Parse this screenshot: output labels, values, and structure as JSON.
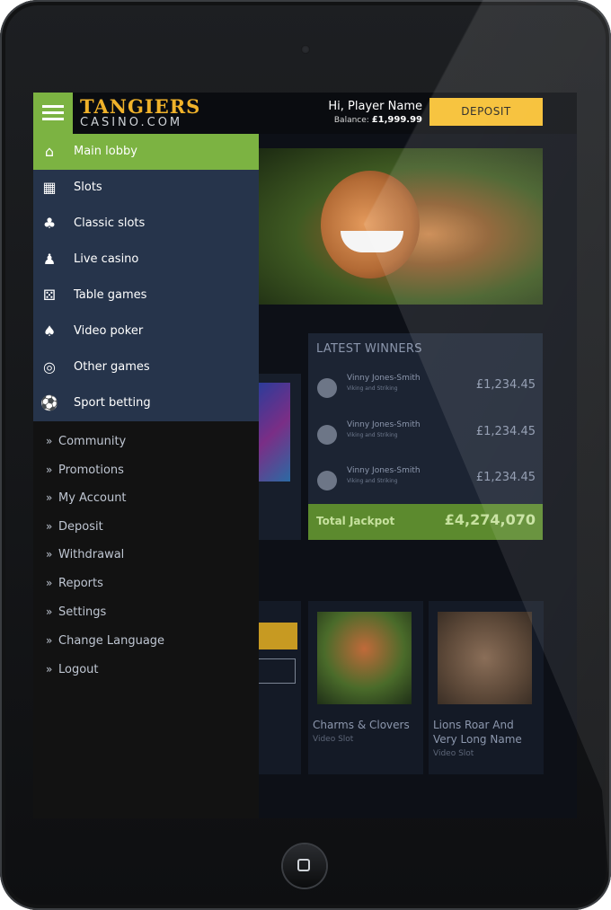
{
  "header": {
    "logo_line1": "TANGIERS",
    "logo_line2": "CASINO.COM",
    "greeting": "Hi, Player Name",
    "balance_label": "Balance:",
    "balance_value": "£1,999.99",
    "deposit_label": "DEPOSIT"
  },
  "menu": {
    "items": [
      {
        "label": "Main lobby",
        "icon": "home-icon",
        "active": true
      },
      {
        "label": "Slots",
        "icon": "slot-machine-icon"
      },
      {
        "label": "Classic slots",
        "icon": "cherries-icon"
      },
      {
        "label": "Live casino",
        "icon": "dealer-icon"
      },
      {
        "label": "Table games",
        "icon": "dice-icon"
      },
      {
        "label": "Video poker",
        "icon": "cards-icon"
      },
      {
        "label": "Other games",
        "icon": "chip-icon"
      },
      {
        "label": "Sport betting",
        "icon": "football-icon"
      }
    ],
    "sub_items": [
      "Community",
      "Promotions",
      "My Account",
      "Deposit",
      "Withdrawal",
      "Reports",
      "Settings",
      "Change Language",
      "Logout"
    ]
  },
  "winners": {
    "title": "LATEST WINNERS",
    "rows": [
      {
        "name": "Vinny Jones-Smith",
        "game": "Viking and Striking",
        "amount": "£1,234.45"
      },
      {
        "name": "Vinny Jones-Smith",
        "game": "Viking and Striking",
        "amount": "£1,234.45"
      },
      {
        "name": "Vinny Jones-Smith",
        "game": "Viking and Striking",
        "amount": "£1,234.45"
      }
    ],
    "jackpot_label": "Total Jackpot",
    "jackpot_value": "£4,274,070"
  },
  "games": [
    {
      "title": "Charms & Clovers",
      "subtitle": "Video Slot"
    },
    {
      "title": "Lions Roar And Very Long Name",
      "subtitle": "Video Slot"
    }
  ],
  "colors": {
    "accent_green": "#7cb342",
    "deposit_yellow": "#f6bd2b",
    "menu_blue": "#26344b",
    "logo_gold": "#f0b22a"
  }
}
